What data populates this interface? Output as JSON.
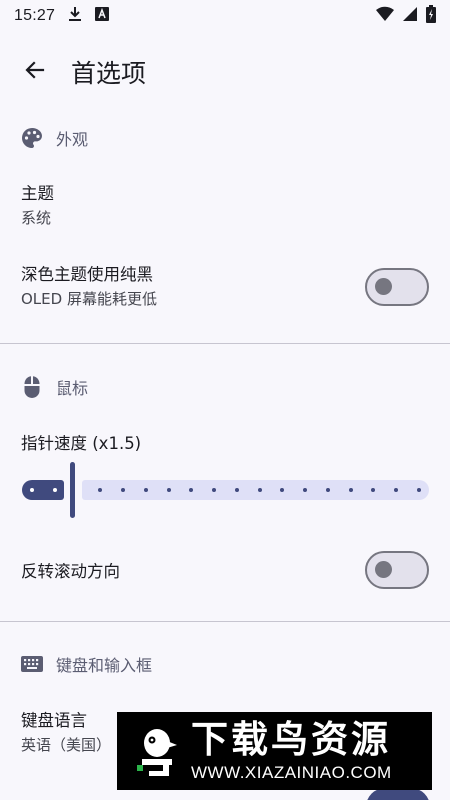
{
  "status_bar": {
    "time": "15:27",
    "icons": [
      "download-icon",
      "font-a-icon",
      "wifi-icon",
      "signal-icon",
      "battery-charging-icon"
    ]
  },
  "app_bar": {
    "title": "首选项"
  },
  "sections": {
    "appearance": {
      "title": "外观",
      "icon": "palette-icon"
    },
    "mouse": {
      "title": "鼠标",
      "icon": "mouse-icon"
    },
    "keyboard": {
      "title": "键盘和输入框",
      "icon": "keyboard-icon"
    }
  },
  "prefs": {
    "theme": {
      "title": "主题",
      "summary": "系统"
    },
    "pure_black": {
      "title": "深色主题使用纯黑",
      "summary": "OLED 屏幕能耗更低",
      "enabled": false
    },
    "pointer_speed": {
      "title": "指针速度 (x1.5)",
      "value": 1.5,
      "position_fraction": 0.1
    },
    "reverse_scroll": {
      "title": "反转滚动方向",
      "enabled": false
    },
    "keyboard_lang": {
      "title": "键盘语言",
      "summary": "英语（美国）"
    }
  },
  "watermark": {
    "text_cn": "下载鸟资源",
    "url": "WWW.XIAZAINIAO.COM"
  },
  "colors": {
    "background": "#f8f7fc",
    "primary": "#404a7e",
    "track_inactive": "#dfe0f7",
    "switch_off_track": "#e3e1ec",
    "switch_outline": "#767680",
    "section_title": "#5b5d72"
  }
}
